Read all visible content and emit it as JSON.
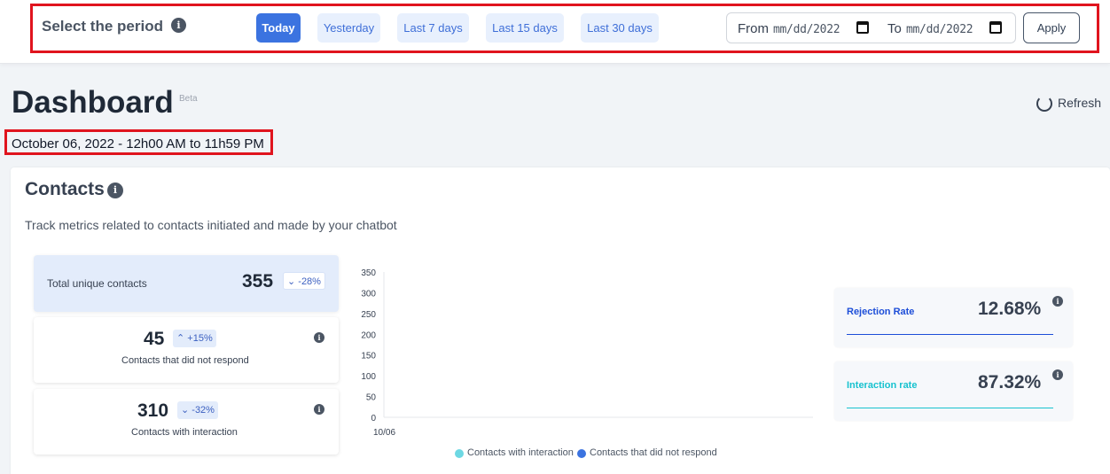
{
  "period": {
    "title": "Select the period",
    "buttons": [
      "Today",
      "Yesterday",
      "Last 7 days",
      "Last 15 days",
      "Last 30 days"
    ],
    "active_index": 0,
    "from_label": "From",
    "from_value": "mm/dd/2022",
    "to_label": "To",
    "to_value": "mm/dd/2022",
    "apply": "Apply",
    "info_glyph": "i"
  },
  "header": {
    "title": "Dashboard",
    "beta": "Beta",
    "refresh": "Refresh",
    "date_range": "October 06, 2022 - 12h00 AM to 11h59 PM"
  },
  "contacts": {
    "title": "Contacts",
    "subtitle": "Track metrics related to contacts initiated and made by your chatbot",
    "metrics": [
      {
        "label": "Total unique contacts",
        "value": "355",
        "change": "-28%",
        "direction": "down"
      },
      {
        "label": "Contacts that did not respond",
        "value": "45",
        "change": "+15%",
        "direction": "up"
      },
      {
        "label": "Contacts with interaction",
        "value": "310",
        "change": "-32%",
        "direction": "down"
      }
    ],
    "rates": [
      {
        "label": "Rejection Rate",
        "value": "12.68%",
        "color": "#1d4ed8"
      },
      {
        "label": "Interaction rate",
        "value": "87.32%",
        "color": "#17c2cf"
      }
    ]
  },
  "chart_data": {
    "type": "bar",
    "categories": [
      "10/06"
    ],
    "series": [
      {
        "name": "Contacts with interaction",
        "values": [
          0
        ],
        "color": "#6dd8e3"
      },
      {
        "name": "Contacts that did not respond",
        "values": [
          0
        ],
        "color": "#3b73e0"
      }
    ],
    "yticks": [
      0,
      50,
      100,
      150,
      200,
      250,
      300,
      350
    ],
    "ylim": [
      0,
      350
    ],
    "legend_position": "bottom"
  },
  "colors": {
    "accent": "#3b73e0",
    "highlight_border": "#e0141e",
    "badge_text": "#3b5fc0"
  }
}
